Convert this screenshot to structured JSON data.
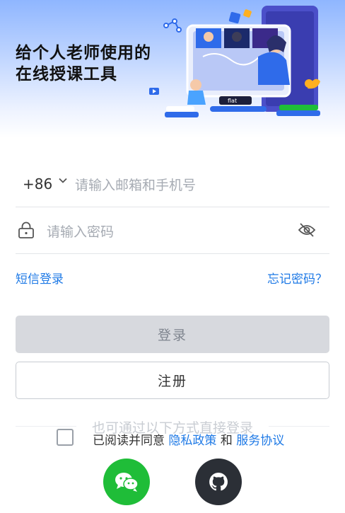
{
  "hero": {
    "title_line1": "给个人老师使用的",
    "title_line2": "在线授课工具",
    "illustration_label": "flat"
  },
  "login": {
    "country_code": "+86",
    "phone_placeholder": "请输入邮箱和手机号",
    "password_placeholder": "请输入密码",
    "sms_login_label": "短信登录",
    "forgot_password_label": "忘记密码？",
    "login_button": "登录",
    "register_button": "注册"
  },
  "divider_text": "也可通过以下方式直接登录",
  "agreement": {
    "prefix": "已阅读并同意",
    "privacy_policy": "隐私政策",
    "conjunction": "和",
    "service_agreement": "服务协议",
    "checked": false
  },
  "social": [
    {
      "name": "wechat",
      "icon": "wechat-icon",
      "color": "#1fbd38"
    },
    {
      "name": "github",
      "icon": "github-icon",
      "color": "#2b2f36"
    }
  ],
  "colors": {
    "accent": "#1f7ae6",
    "login_button_bg": "#d7d9de",
    "wechat": "#1fbd38",
    "github": "#2b2f36"
  }
}
